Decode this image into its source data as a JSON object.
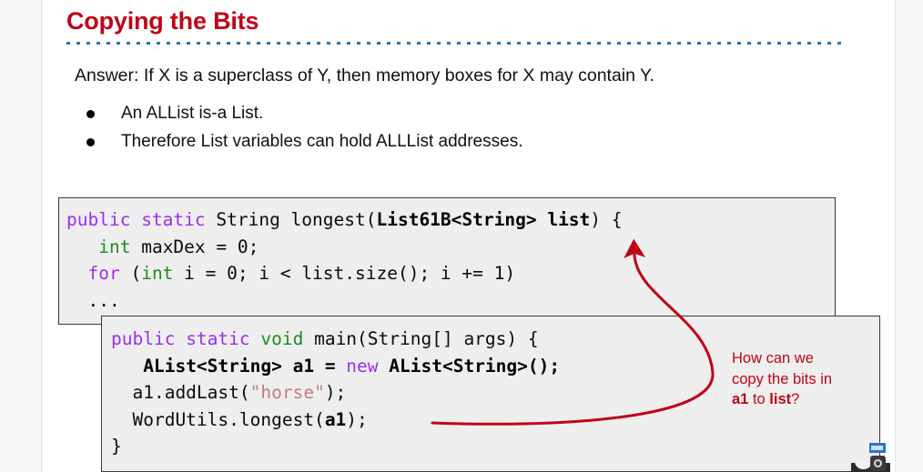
{
  "slide": {
    "title": "Copying the Bits",
    "answer_line": "Answer: If X is a superclass of Y, then memory boxes for X may contain Y.",
    "bullets": [
      "An ALList is-a List.",
      "Therefore List variables can hold ALLList addresses."
    ],
    "title_color": "#c00418",
    "rule_color": "#2e75b6"
  },
  "code_block_1": {
    "lines": [
      [
        {
          "t": "public ",
          "s": "kw"
        },
        {
          "t": "static ",
          "s": "kw"
        },
        {
          "t": "String longest(",
          "s": "plain"
        },
        {
          "t": "List61B<String> list",
          "s": "bold"
        },
        {
          "t": ") {",
          "s": "plain"
        }
      ],
      [
        {
          "t": "   ",
          "s": "plain"
        },
        {
          "t": "int",
          "s": "type"
        },
        {
          "t": " maxDex = 0;",
          "s": "plain"
        }
      ],
      [
        {
          "t": "  ",
          "s": "plain"
        },
        {
          "t": "for",
          "s": "kw"
        },
        {
          "t": " (",
          "s": "plain"
        },
        {
          "t": "int",
          "s": "type"
        },
        {
          "t": " i = 0; i < list.size(); i += 1)",
          "s": "plain"
        }
      ],
      [
        {
          "t": "  ...",
          "s": "plain"
        }
      ]
    ]
  },
  "code_block_2": {
    "lines": [
      [
        {
          "t": "public ",
          "s": "kw"
        },
        {
          "t": "static ",
          "s": "kw"
        },
        {
          "t": "void",
          "s": "type"
        },
        {
          "t": " main(String[] args) {",
          "s": "plain"
        }
      ],
      [
        {
          "t": "   ",
          "s": "plain"
        },
        {
          "t": "AList<String> a1 = ",
          "s": "bold"
        },
        {
          "t": "new",
          "s": "kw"
        },
        {
          "t": " AList<String>();",
          "s": "bold"
        }
      ],
      [
        {
          "t": "  a1.addLast(",
          "s": "plain"
        },
        {
          "t": "\"horse\"",
          "s": "str"
        },
        {
          "t": ");",
          "s": "plain"
        }
      ],
      [
        {
          "t": "  WordUtils.longest(",
          "s": "plain"
        },
        {
          "t": "a1",
          "s": "bold"
        },
        {
          "t": ");",
          "s": "plain"
        }
      ],
      [
        {
          "t": "}",
          "s": "plain"
        }
      ]
    ]
  },
  "annotation": {
    "line1": "How can we",
    "line2": "copy the bits in",
    "line3_pre": "",
    "line3_bold1": "a1",
    "line3_mid": " to ",
    "line3_bold2": "list",
    "line3_post": "?",
    "color": "#c00418"
  },
  "arrow": {
    "name": "curved-red-arrow",
    "color": "#c00418",
    "from_label": "a1",
    "to_label": "list"
  },
  "corner": {
    "badge_label": "",
    "gear_label": ""
  }
}
